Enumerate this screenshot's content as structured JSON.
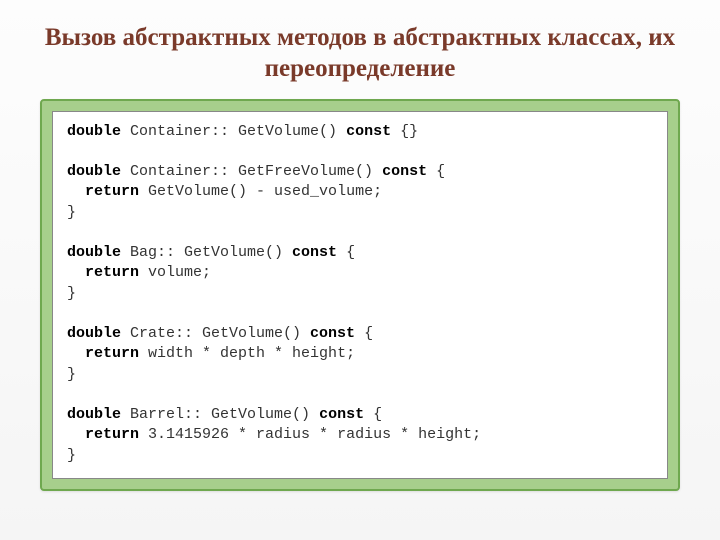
{
  "title": "Вызов абстрактных методов в абстрактных классах, их переопределение",
  "code": {
    "l1_kw1": "double",
    "l1_txt1": " Container:: GetVolume() ",
    "l1_kw2": "const",
    "l1_txt2": " {}",
    "l3_kw1": "double",
    "l3_txt1": " Container:: GetFreeVolume() ",
    "l3_kw2": "const",
    "l3_txt2": " {",
    "l4_ind": "  ",
    "l4_kw1": "return",
    "l4_txt1": " GetVolume() - used_volume;",
    "l5": "}",
    "l7_kw1": "double",
    "l7_txt1": " Bag:: GetVolume() ",
    "l7_kw2": "const",
    "l7_txt2": " {",
    "l8_ind": "  ",
    "l8_kw1": "return",
    "l8_txt1": " volume;",
    "l9": "}",
    "l11_kw1": "double",
    "l11_txt1": " Crate:: GetVolume() ",
    "l11_kw2": "const",
    "l11_txt2": " {",
    "l12_ind": "  ",
    "l12_kw1": "return",
    "l12_txt1": " width * depth * height;",
    "l13": "}",
    "l15_kw1": "double",
    "l15_txt1": " Barrel:: GetVolume() ",
    "l15_kw2": "const",
    "l15_txt2": " {",
    "l16_ind": "  ",
    "l16_kw1": "return",
    "l16_txt1": " 3.1415926 * radius * radius * height;",
    "l17": "}"
  }
}
